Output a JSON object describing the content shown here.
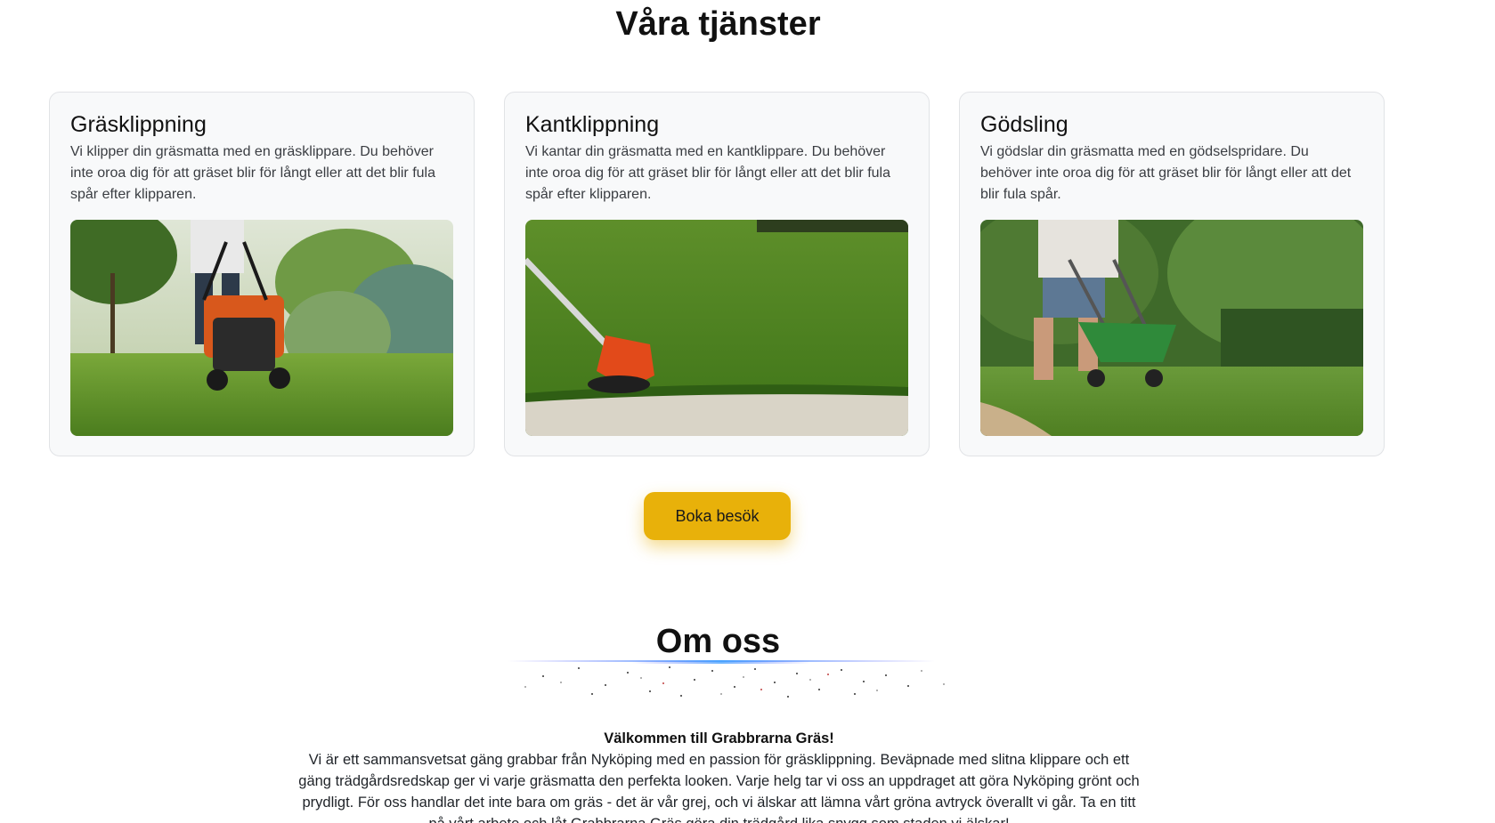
{
  "services": {
    "title": "Våra tjänster",
    "cards": [
      {
        "title": "Gräsklippning",
        "text": "Vi klipper din gräsmatta med en gräsklippare. Du behöver inte oroa dig för att gräset blir för långt eller att det blir fula spår efter klipparen.",
        "image": "lawn-mower-photo"
      },
      {
        "title": "Kantklippning",
        "text": "Vi kantar din gräsmatta med en kantklippare. Du behöver inte oroa dig för att gräset blir för långt eller att det blir fula spår efter klipparen.",
        "image": "edge-trimmer-photo"
      },
      {
        "title": "Gödsling",
        "text": "Vi gödslar din gräsmatta med en gödselspridare. Du behöver inte oroa dig för att gräset blir för långt eller att det blir fula spår.",
        "image": "fertilizer-spreader-photo"
      }
    ]
  },
  "cta": {
    "label": "Boka besök",
    "color": "#e8b10a"
  },
  "about": {
    "title": "Om oss",
    "heading": "Välkommen till Grabbrarna Gräs!",
    "text": "Vi är ett sammansvetsat gäng grabbar från Nyköping med en passion för gräsklippning. Beväpnade med slitna klippare och ett gäng trädgårdsredskap ger vi varje gräsmatta den perfekta looken. Varje helg tar vi oss an uppdraget att göra Nyköping grönt och prydligt. För oss handlar det inte bara om gräs - det är vår grej, och vi älskar att lämna vårt gröna avtryck överallt vi går. Ta en titt på vårt arbete och låt Grabbrarna Gräs göra din trädgård lika snygg som staden vi älskar!"
  }
}
